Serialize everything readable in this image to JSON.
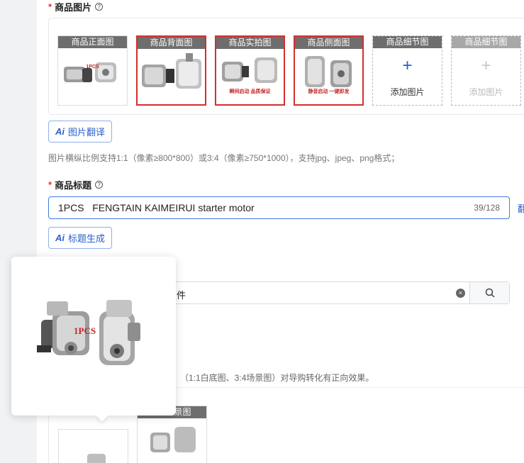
{
  "section_images": {
    "title": "商品图片",
    "help": "?",
    "slots": [
      {
        "caption": "商品正面图",
        "tag": "1PCS"
      },
      {
        "caption": "商品背面图",
        "tag": ""
      },
      {
        "caption": "商品实拍图",
        "tag": "瞬间启动    品质保证"
      },
      {
        "caption": "商品侧面图",
        "tag": "静音启动    一键即发"
      },
      {
        "caption": "商品细节图",
        "add_label": "添加图片"
      },
      {
        "caption": "商品细节图",
        "add_label": "添加图片"
      }
    ],
    "translate_button": "图片翻译",
    "ai_mark": "Ai",
    "hint": "图片横纵比例支持1:1（像素≥800*800）或3:4（像素≥750*1000），支持jpg、jpeg、png格式；"
  },
  "section_title": {
    "title": "商品标题",
    "help": "?",
    "value": "1PCS   FENGTAIN KAIMEIRUI starter motor",
    "count": "39/128",
    "side_link": "翻",
    "generate_button": "标题生成",
    "ai_mark": "Ai"
  },
  "category_search": {
    "value": "件",
    "clear_icon": "×"
  },
  "white_bg_hint": "（1:1白底图、3:4场景图）对导购转化有正向效果。",
  "bottom_slots": {
    "second_caption": "景图"
  },
  "popover": {
    "tag": "1PCS"
  },
  "colors": {
    "accent": "#3f7ae0",
    "required": "#e33333",
    "caption_bg": "#6e6e6e",
    "highlight_border": "#d32f2f"
  }
}
